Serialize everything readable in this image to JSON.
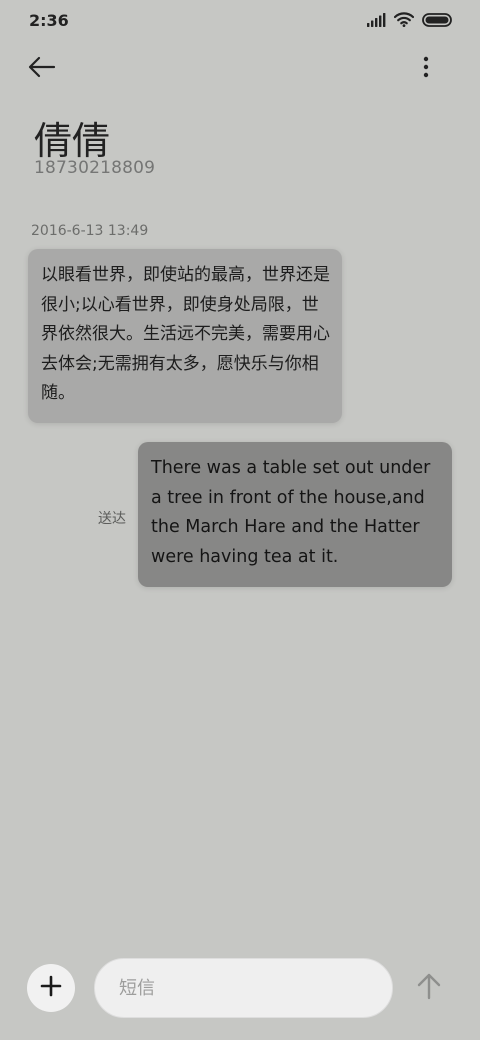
{
  "status_bar": {
    "time": "2:36",
    "icons": [
      "signal-icon",
      "wifi-icon",
      "battery-icon"
    ]
  },
  "header": {
    "back_icon": "back-arrow-icon",
    "more_icon": "more-vertical-icon",
    "contact_name": "倩倩",
    "contact_number": "18730218809"
  },
  "conversation": {
    "timestamp": "2016-6-13 13:49",
    "messages": [
      {
        "direction": "incoming",
        "text": "以眼看世界，即使站的最高，世界还是很小;以心看世界，即使身处局限，世界依然很大。生活远不完美，需要用心去体会;无需拥有太多，愿快乐与你相随。"
      },
      {
        "direction": "outgoing",
        "status": "送达",
        "text": "There was a table set out under a tree in front of the house,and the March Hare and the Hatter were having tea at it."
      }
    ]
  },
  "compose": {
    "attach_icon": "plus-icon",
    "placeholder": "短信",
    "value": "",
    "send_icon": "send-arrow-icon"
  },
  "colors": {
    "background": "#c6c7c4",
    "incoming_bubble": "#a9a9a8",
    "outgoing_bubble": "#878786",
    "input_background": "#efefef"
  }
}
